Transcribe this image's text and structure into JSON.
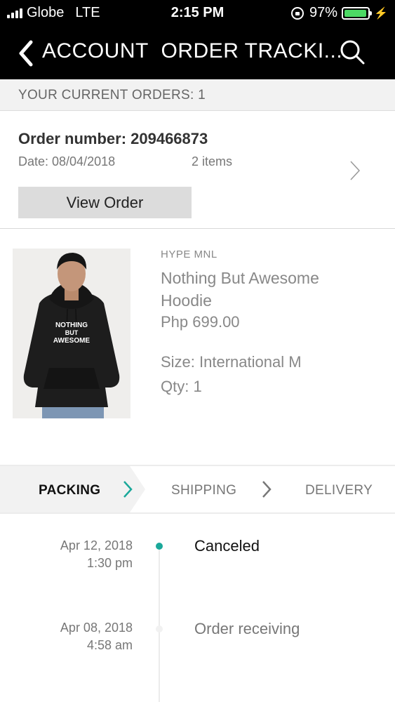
{
  "status_bar": {
    "carrier": "Globe",
    "network": "LTE",
    "time": "2:15 PM",
    "battery_percent": "97%",
    "battery_level": 0.97,
    "battery_color": "#4cd964"
  },
  "nav": {
    "back_icon": "chevron-left-icon",
    "title_part1": "ACCOUNT",
    "title_part2": "ORDER TRACKI...",
    "search_icon": "search-icon"
  },
  "orders": {
    "header": "YOUR CURRENT ORDERS: 1",
    "order_number": "Order number: 209466873",
    "date": "Date: 08/04/2018",
    "items": "2 items",
    "view_button": "View Order"
  },
  "product": {
    "brand": "HYPE MNL",
    "name": "Nothing But Awesome   Hoodie",
    "price": "Php 699.00",
    "size": "Size: International M",
    "qty": "Qty: 1",
    "shirt_print_line1": "NOTHING",
    "shirt_print_line2": "BUT",
    "shirt_print_line3": "AWESOME"
  },
  "tracking_tabs": {
    "packing": "PACKING",
    "shipping": "SHIPPING",
    "delivery": "DELIVERY",
    "accent_color": "#1aa89a"
  },
  "timeline": [
    {
      "date": "Apr 12, 2018",
      "time": "1:30 pm",
      "status": "Canceled"
    },
    {
      "date": "Apr 08, 2018",
      "time": "4:58 am",
      "status": "Order receiving"
    }
  ]
}
